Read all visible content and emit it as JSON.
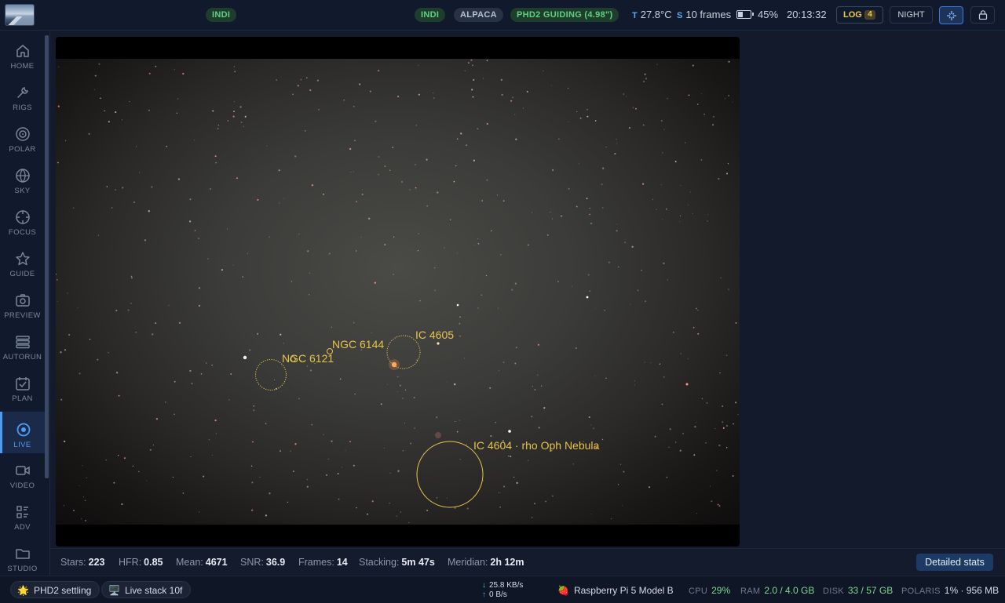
{
  "topbar": {
    "indi_left": "INDI",
    "indi": "INDI",
    "alpaca": "ALPACA",
    "phd2": "PHD2 GUIDING (4.98\")",
    "temp_label": "T",
    "temp_value": "27.8°C",
    "stack_label": "S",
    "stack_value": "10 frames",
    "battery_percent": "45%",
    "battery_level": 0.45,
    "time": "20:13:32",
    "log_label": "LOG",
    "log_count": "4",
    "night_label": "NIGHT",
    "crosshair_icon": "crosshair-icon",
    "lock_icon": "lock-icon"
  },
  "sidebar": {
    "items": [
      {
        "label": "HOME",
        "icon": "home-icon"
      },
      {
        "label": "RIGS",
        "icon": "wrench-icon"
      },
      {
        "label": "POLAR",
        "icon": "target-icon"
      },
      {
        "label": "SKY",
        "icon": "globe-icon"
      },
      {
        "label": "FOCUS",
        "icon": "focus-icon"
      },
      {
        "label": "GUIDE",
        "icon": "star-icon"
      },
      {
        "label": "PREVIEW",
        "icon": "camera-icon"
      },
      {
        "label": "AUTORUN",
        "icon": "stack-icon"
      },
      {
        "label": "PLAN",
        "icon": "calendar-icon"
      },
      {
        "label": "LIVE",
        "icon": "live-icon",
        "active": true
      },
      {
        "label": "VIDEO",
        "icon": "video-icon"
      },
      {
        "label": "ADV",
        "icon": "list-icon"
      },
      {
        "label": "STUDIO",
        "icon": "folder-icon"
      }
    ]
  },
  "annotations": [
    {
      "label": "NGC 6121"
    },
    {
      "label": "NGC 6144"
    },
    {
      "label": "IC 4605"
    },
    {
      "label": "IC 4604 · rho Oph Nebula"
    }
  ],
  "stats": {
    "stars_label": "Stars:",
    "stars": "223",
    "hfr_label": "HFR:",
    "hfr": "0.85",
    "mean_label": "Mean:",
    "mean": "4671",
    "snr_label": "SNR:",
    "snr": "36.9",
    "frames_label": "Frames:",
    "frames": "14",
    "stacking_label": "Stacking:",
    "stacking": "5m 47s",
    "meridian_label": "Meridian:",
    "meridian": "2h 12m",
    "detailed_button": "Detailed stats"
  },
  "footer": {
    "phd2_status": "PHD2 settling",
    "live_stack": "Live stack 10f",
    "net_down": "25.8 KB/s",
    "net_up": "0 B/s",
    "device": "Raspberry Pi 5 Model B",
    "cpu_label": "CPU",
    "cpu": "29%",
    "ram_label": "RAM",
    "ram": "2.0 / 4.0 GB",
    "disk_label": "DISK",
    "disk": "33 / 57 GB",
    "polaris_label": "POLARIS",
    "polaris": "1% · 956 MB"
  },
  "colors": {
    "accent": "#4e9bf5",
    "annotation": "#e6c44a",
    "status_green": "#5ed17f",
    "log_yellow": "#f2c94c"
  }
}
